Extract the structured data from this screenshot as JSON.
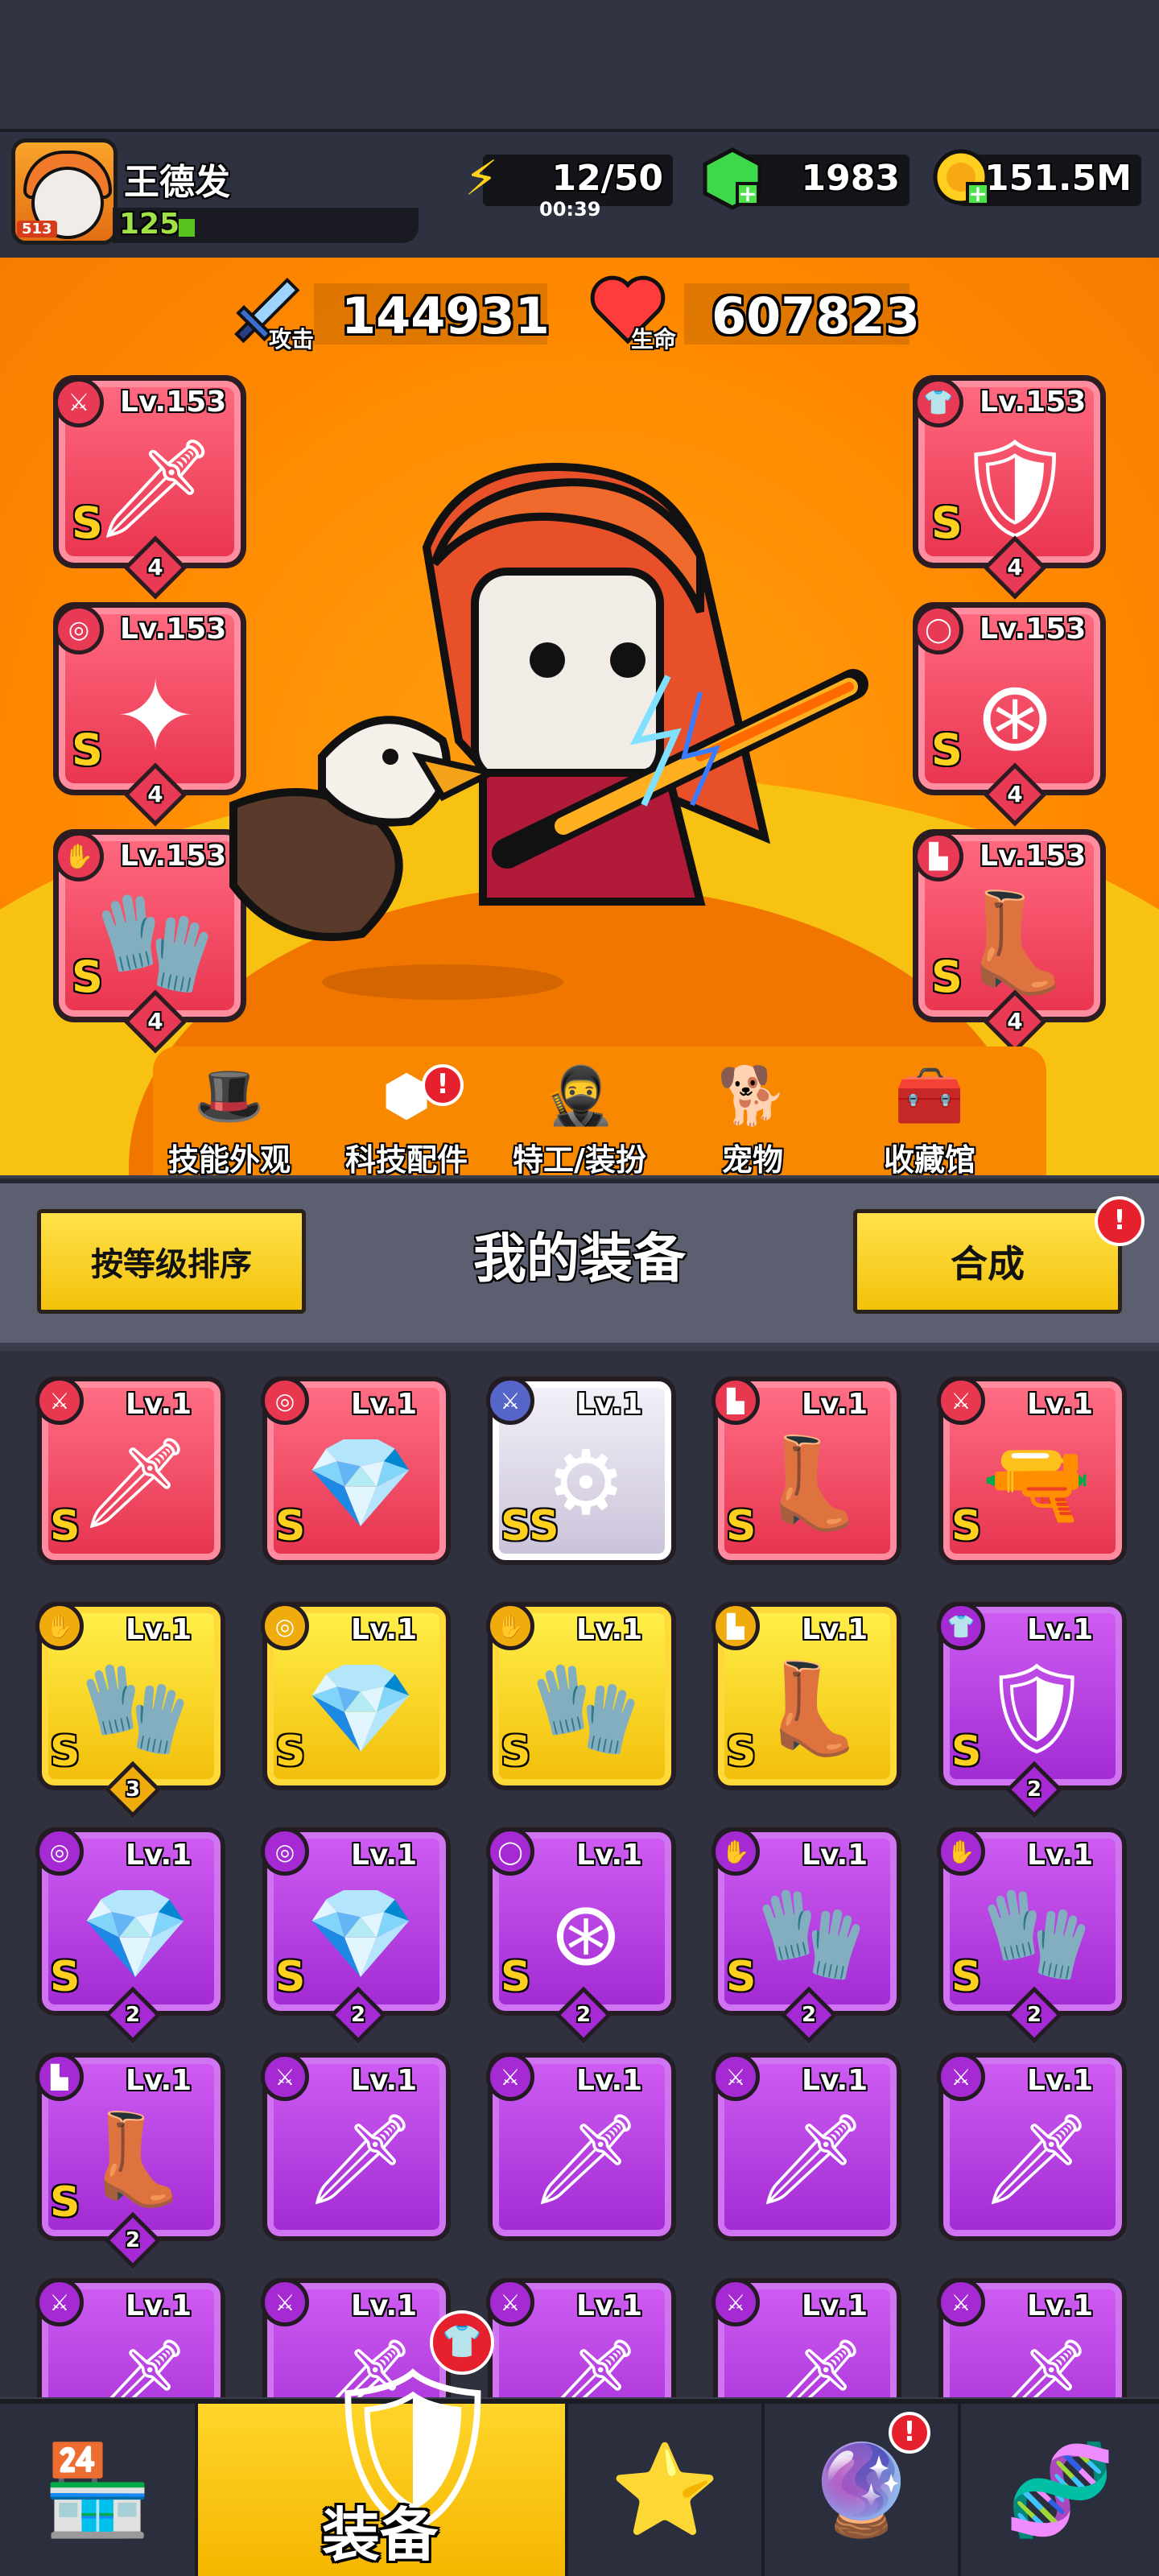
{
  "player": {
    "name": "王德发",
    "level": "125",
    "avatar_badge": "513"
  },
  "resources": {
    "energy": {
      "value": "12/50",
      "timer": "00:39",
      "icon": "lightning-icon"
    },
    "gems": {
      "value": "1983",
      "icon": "gem-icon"
    },
    "gold": {
      "value": "151.5M",
      "icon": "coin-icon"
    }
  },
  "stats": {
    "attack": {
      "label": "攻击",
      "value": "144931"
    },
    "life": {
      "label": "生命",
      "value": "607823"
    }
  },
  "equipped": [
    {
      "slot": "weapon",
      "level": "Lv.153",
      "rarity": "S",
      "stars": "4",
      "icon": "sword-icon"
    },
    {
      "slot": "armor",
      "level": "Lv.153",
      "rarity": "S",
      "stars": "4",
      "icon": "armor-icon"
    },
    {
      "slot": "necklace",
      "level": "Lv.153",
      "rarity": "S",
      "stars": "4",
      "icon": "necklace-icon"
    },
    {
      "slot": "belt",
      "level": "Lv.153",
      "rarity": "S",
      "stars": "4",
      "icon": "belt-icon"
    },
    {
      "slot": "gloves",
      "level": "Lv.153",
      "rarity": "S",
      "stars": "4",
      "icon": "glove-icon"
    },
    {
      "slot": "boots",
      "level": "Lv.153",
      "rarity": "S",
      "stars": "4",
      "icon": "boot-icon"
    }
  ],
  "tabs": [
    {
      "label": "技能外观",
      "icon": "skill-skin-icon"
    },
    {
      "label": "科技配件",
      "icon": "tech-parts-icon",
      "alert": "!"
    },
    {
      "label": "特工/装扮",
      "icon": "agent-icon"
    },
    {
      "label": "宠物",
      "icon": "pet-icon"
    },
    {
      "label": "收藏馆",
      "icon": "collection-icon"
    }
  ],
  "panel": {
    "sort_button": "按等级排序",
    "title": "我的装备",
    "merge_button": "合成",
    "merge_alert": "!"
  },
  "inventory": [
    {
      "level": "Lv.1",
      "rarity": "S",
      "color": "red",
      "icon": "kunai-icon",
      "stars": ""
    },
    {
      "level": "Lv.1",
      "rarity": "S",
      "color": "red",
      "icon": "necklace-icon",
      "stars": ""
    },
    {
      "level": "Lv.1",
      "rarity": "SS",
      "color": "silver",
      "icon": "staff-icon",
      "stars": ""
    },
    {
      "level": "Lv.1",
      "rarity": "S",
      "color": "red",
      "icon": "boot-icon",
      "stars": ""
    },
    {
      "level": "Lv.1",
      "rarity": "S",
      "color": "red",
      "icon": "water-gun-icon",
      "stars": ""
    },
    {
      "level": "Lv.1",
      "rarity": "S",
      "color": "gold",
      "icon": "glove-icon",
      "stars": "3"
    },
    {
      "level": "Lv.1",
      "rarity": "S",
      "color": "gold",
      "icon": "necklace-icon",
      "stars": ""
    },
    {
      "level": "Lv.1",
      "rarity": "S",
      "color": "gold",
      "icon": "glove-icon",
      "stars": ""
    },
    {
      "level": "Lv.1",
      "rarity": "S",
      "color": "gold",
      "icon": "boot-icon",
      "stars": ""
    },
    {
      "level": "Lv.1",
      "rarity": "S",
      "color": "purple",
      "icon": "armor-icon",
      "stars": "2"
    },
    {
      "level": "Lv.1",
      "rarity": "S",
      "color": "purple",
      "icon": "necklace-icon",
      "stars": "2"
    },
    {
      "level": "Lv.1",
      "rarity": "S",
      "color": "purple",
      "icon": "necklace-icon",
      "stars": "2"
    },
    {
      "level": "Lv.1",
      "rarity": "S",
      "color": "purple",
      "icon": "belt-icon",
      "stars": "2"
    },
    {
      "level": "Lv.1",
      "rarity": "S",
      "color": "purple",
      "icon": "glove-icon",
      "stars": "2"
    },
    {
      "level": "Lv.1",
      "rarity": "S",
      "color": "purple",
      "icon": "glove-icon",
      "stars": "2"
    },
    {
      "level": "Lv.1",
      "rarity": "S",
      "color": "purple",
      "icon": "boot-icon",
      "stars": "2"
    },
    {
      "level": "Lv.1",
      "rarity": "",
      "color": "purple",
      "icon": "kunai-icon",
      "stars": ""
    },
    {
      "level": "Lv.1",
      "rarity": "",
      "color": "purple",
      "icon": "kunai-icon",
      "stars": ""
    },
    {
      "level": "Lv.1",
      "rarity": "",
      "color": "purple",
      "icon": "kunai-icon",
      "stars": ""
    },
    {
      "level": "Lv.1",
      "rarity": "",
      "color": "purple",
      "icon": "kunai-icon",
      "stars": ""
    },
    {
      "level": "Lv.1",
      "rarity": "",
      "color": "purple",
      "icon": "kunai-icon",
      "stars": ""
    },
    {
      "level": "Lv.1",
      "rarity": "",
      "color": "purple",
      "icon": "kunai-icon",
      "stars": ""
    },
    {
      "level": "Lv.1",
      "rarity": "",
      "color": "purple",
      "icon": "kunai-icon",
      "stars": ""
    },
    {
      "level": "Lv.1",
      "rarity": "",
      "color": "purple",
      "icon": "kunai-icon",
      "stars": ""
    },
    {
      "level": "Lv.1",
      "rarity": "",
      "color": "purple",
      "icon": "kunai-icon",
      "stars": ""
    }
  ],
  "bottom_nav": [
    {
      "label": "",
      "icon": "shop-icon"
    },
    {
      "label": "装备",
      "icon": "equipment-icon",
      "active": true
    },
    {
      "label": "",
      "icon": "battle-star-icon"
    },
    {
      "label": "",
      "icon": "gacha-ball-icon",
      "alert": "!"
    },
    {
      "label": "",
      "icon": "dna-capsule-icon"
    }
  ],
  "colors": {
    "red": "#e6334e",
    "gold": "#f2bd09",
    "purple": "#a12ad3",
    "orange_bg": "#ff8a00",
    "accent_yellow": "#ffd52b"
  }
}
